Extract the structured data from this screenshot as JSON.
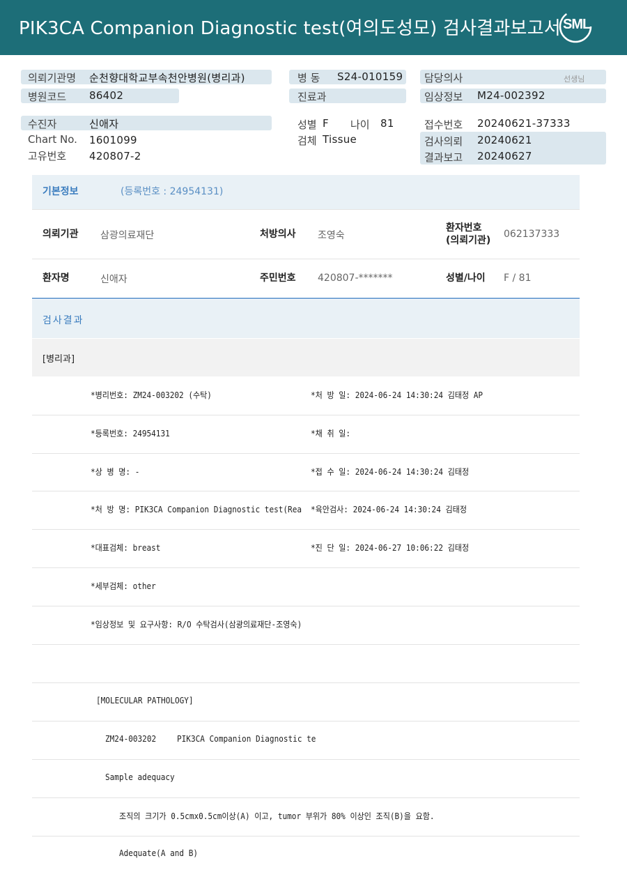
{
  "header": {
    "title": "PIK3CA  Companion  Diagnostic  test(여의도성모) 검사결과보고서",
    "logo": "SML"
  },
  "info": {
    "ordering_org_label": "의뢰기관명",
    "ordering_org_value": "순천향대학교부속천안병원(병리과)",
    "ward_label": "병  동",
    "ward_value": "S24-010159",
    "doctor_label": "담당의사",
    "doctor_suffix": "선생님",
    "hospital_code_label": "병원코드",
    "hospital_code_value": "86402",
    "department_label": "진료과",
    "clinical_info_label": "임상정보",
    "clinical_info_value": "M24-002392",
    "patient_label": "수진자",
    "patient_value": "신애자",
    "sex_label": "성별",
    "sex_value": "F",
    "age_label": "나이",
    "age_value": "81",
    "receipt_no_label": "접수번호",
    "receipt_no_value": "20240621-37333",
    "chart_label": "Chart No.",
    "chart_value": "1601099",
    "specimen_label": "검체",
    "specimen_value": "Tissue",
    "test_request_label": "검사의뢰",
    "test_request_value": "20240621",
    "unique_no_label": "고유번호",
    "unique_no_value": "420807-2",
    "result_report_label": "결과보고",
    "result_report_value": "20240627"
  },
  "basic": {
    "title": "기본정보",
    "subtitle": "(등록번호 : 24954131)",
    "org_label": "의뢰기관",
    "org_value": "삼광의료재단",
    "prescriber_label": "처방의사",
    "prescriber_value": "조영숙",
    "patient_no_label_1": "환자번호",
    "patient_no_label_2": "(의뢰기관)",
    "patient_no_value": "062137333",
    "name_label": "환자명",
    "name_value": "신애자",
    "resident_label": "주민번호",
    "resident_value": "420807-*******",
    "sexage_label": "성별/나이",
    "sexage_value": "F / 81"
  },
  "result": {
    "title": "검사결과",
    "dept": "[병리과]",
    "lines": [
      {
        "left": "*병리번호: ZM24-003202 (수탁)",
        "right": "*처 방 일: 2024-06-24 14:30:24  김태정 AP"
      },
      {
        "left": "*등록번호: 24954131",
        "right": "*채 취 일:"
      },
      {
        "left": "*상 병 명: -",
        "right": "*접 수 일: 2024-06-24 14:30:24  김태정"
      },
      {
        "left": "*처 방 명: PIK3CA Companion Diagnostic test(Rea",
        "right": "*육안검사: 2024-06-24 14:30:24  김태정"
      },
      {
        "left": "*대표검체: breast",
        "right": "*진 단 일: 2024-06-27 10:06:22  김태정"
      },
      {
        "left": "*세부검체: other",
        "right": ""
      },
      {
        "left": "*임상정보 및 요구사항: R/O 수탁검사(삼광의료재단-조영숙)",
        "right": ""
      }
    ],
    "molecular": "[MOLECULAR PATHOLOGY]",
    "code_line_code": "ZM24-003202",
    "code_line_test": "PIK3CA Companion Diagnostic te",
    "sample_adequacy": "Sample adequacy",
    "criteria": "조직의 크기가 0.5cmx0.5cm이상(A) 이고, tumor 부위가 80% 이상인 조직(B)을 요함.",
    "adequate": "Adequate(A and B)"
  }
}
